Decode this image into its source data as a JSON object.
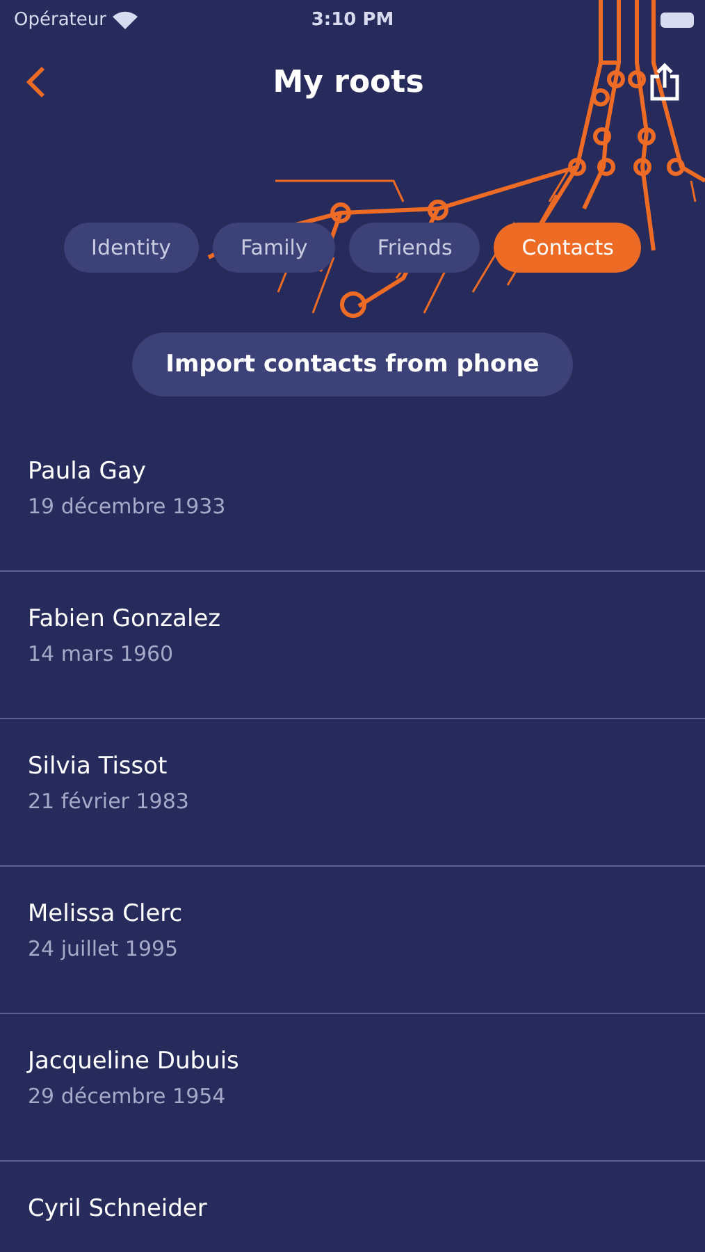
{
  "status_bar": {
    "carrier": "Opérateur",
    "time": "3:10 PM"
  },
  "nav": {
    "title": "My roots"
  },
  "tabs": [
    {
      "label": "Identity",
      "selected": false
    },
    {
      "label": "Family",
      "selected": false
    },
    {
      "label": "Friends",
      "selected": false
    },
    {
      "label": "Contacts",
      "selected": true
    }
  ],
  "import_button": "Import contacts from phone",
  "contacts": [
    {
      "name": "Paula Gay",
      "date": "19 décembre 1933"
    },
    {
      "name": "Fabien Gonzalez",
      "date": "14 mars 1960"
    },
    {
      "name": "Silvia Tissot",
      "date": "21 février 1983"
    },
    {
      "name": "Melissa Clerc",
      "date": "24 juillet 1995"
    },
    {
      "name": "Jacqueline Dubuis",
      "date": "29 décembre 1954"
    },
    {
      "name": "Cyril Schneider"
    }
  ]
}
